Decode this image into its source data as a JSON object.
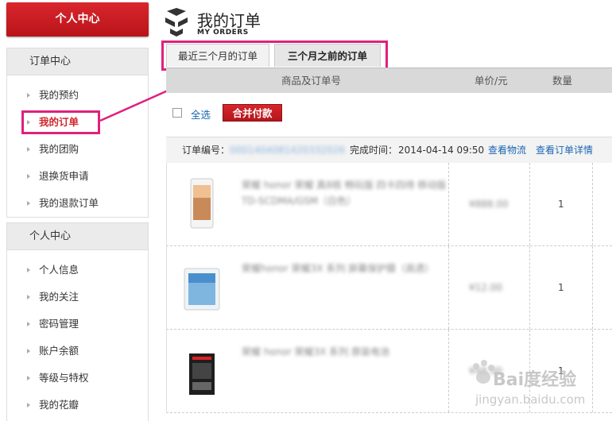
{
  "sidebar": {
    "personal_center_button": "个人中心",
    "groups": [
      {
        "title": "订单中心",
        "items": [
          "我的预约",
          "我的订单",
          "我的团购",
          "退换货申请",
          "我的退款订单"
        ]
      },
      {
        "title": "个人中心",
        "items": [
          "个人信息",
          "我的关注",
          "密码管理",
          "账户余额",
          "等级与特权",
          "我的花瓣"
        ]
      }
    ]
  },
  "header": {
    "title": "我的订单",
    "subtitle": "MY ORDERS"
  },
  "tabs": [
    {
      "label": "最近三个月的订单"
    },
    {
      "label": "三个月之前的订单"
    }
  ],
  "table_header": {
    "product": "商品及订单号",
    "unit_price": "单价/元",
    "quantity": "数量"
  },
  "select_bar": {
    "select_all": "全选",
    "merge_pay": "合并付款"
  },
  "order": {
    "number_label": "订单编号：",
    "number_value": "0001404081420332026",
    "time_label": "完成时间：",
    "time_value": "2014-04-14  09:50",
    "view_logistics": "查看物流",
    "view_detail": "查看订单详情"
  },
  "items": [
    {
      "name": "荣耀 honor 荣耀 真8核 畅玩版 四卡四待 移动版 TD-SCDMA/GSM（白色）",
      "price": "¥888.00",
      "qty": "1"
    },
    {
      "name": "荣耀honor 荣耀3X 系列 屏幕保护膜（高透）",
      "price": "¥12.00",
      "qty": "1"
    },
    {
      "name": "荣耀 honor 荣耀3X 系列 原装电池",
      "price": "¥48.00",
      "qty": "1"
    }
  ],
  "watermark": {
    "line1": "Bai度经验",
    "line2": "jingyan.baidu.com"
  },
  "colors": {
    "accent_red": "#d2262c",
    "highlight_pink": "#e0207e",
    "link_blue": "#1a66b3"
  }
}
